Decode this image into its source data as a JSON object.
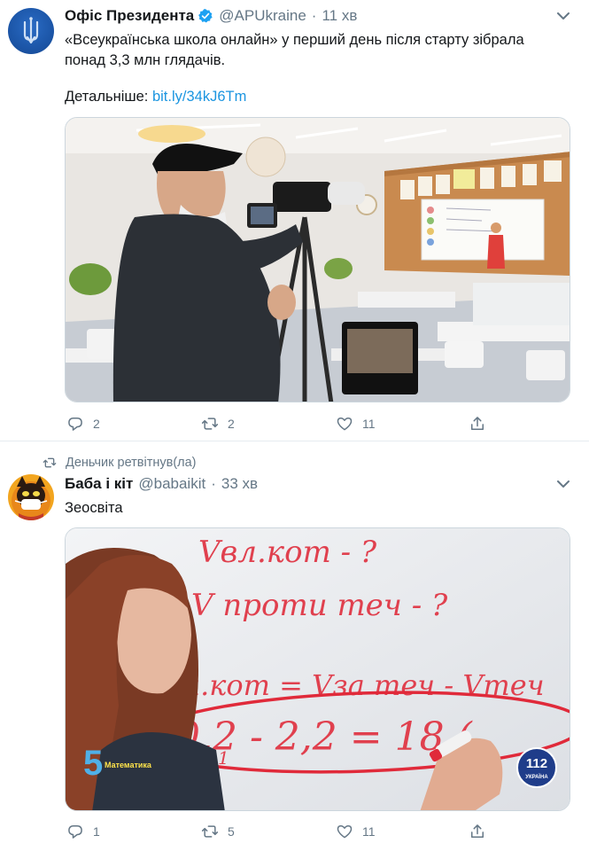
{
  "tweet1": {
    "author_name": "Офіс Президента",
    "handle": "@APUkraine",
    "separator": "·",
    "time": "11 хв",
    "text_line1": "«Всеукраїнська школа онлайн» у перший день після старту зібрала",
    "text_line2": "понад 3,3 млн глядачів.",
    "more_label": "Детальніше:",
    "link": "bit.ly/34kJ6Tm",
    "replies": "2",
    "retweets": "2",
    "likes": "11"
  },
  "tweet2": {
    "retweeted_by": "Деньчик ретвітнув(ла)",
    "author_name": "Баба і кіт",
    "handle": "@babaikit",
    "separator": "·",
    "time": "33 хв",
    "text": "Зеосвіта",
    "video_overlay": {
      "channel_logo": "5",
      "subject_label": "Математика",
      "corner_logo": "112",
      "corner_logo_sub": "УКРАЇНА",
      "board_line1": "Vвл.кот - ?",
      "board_line2": "V проти теч - ?",
      "board_line3": "Vвл.кот = Vза теч - Vтеч",
      "board_line4": "30,2 - 2,2 = 18 (",
      "board_small_digit": "1"
    },
    "replies": "1",
    "retweets": "5",
    "likes": "11"
  },
  "colors": {
    "accent": "#1b95e0",
    "muted": "#657786",
    "verified": "#1da1f2",
    "marker_red": "#e02a3a"
  },
  "icons": [
    "verified-badge-icon",
    "chevron-down-icon",
    "reply-icon",
    "retweet-icon",
    "like-icon",
    "share-icon"
  ]
}
